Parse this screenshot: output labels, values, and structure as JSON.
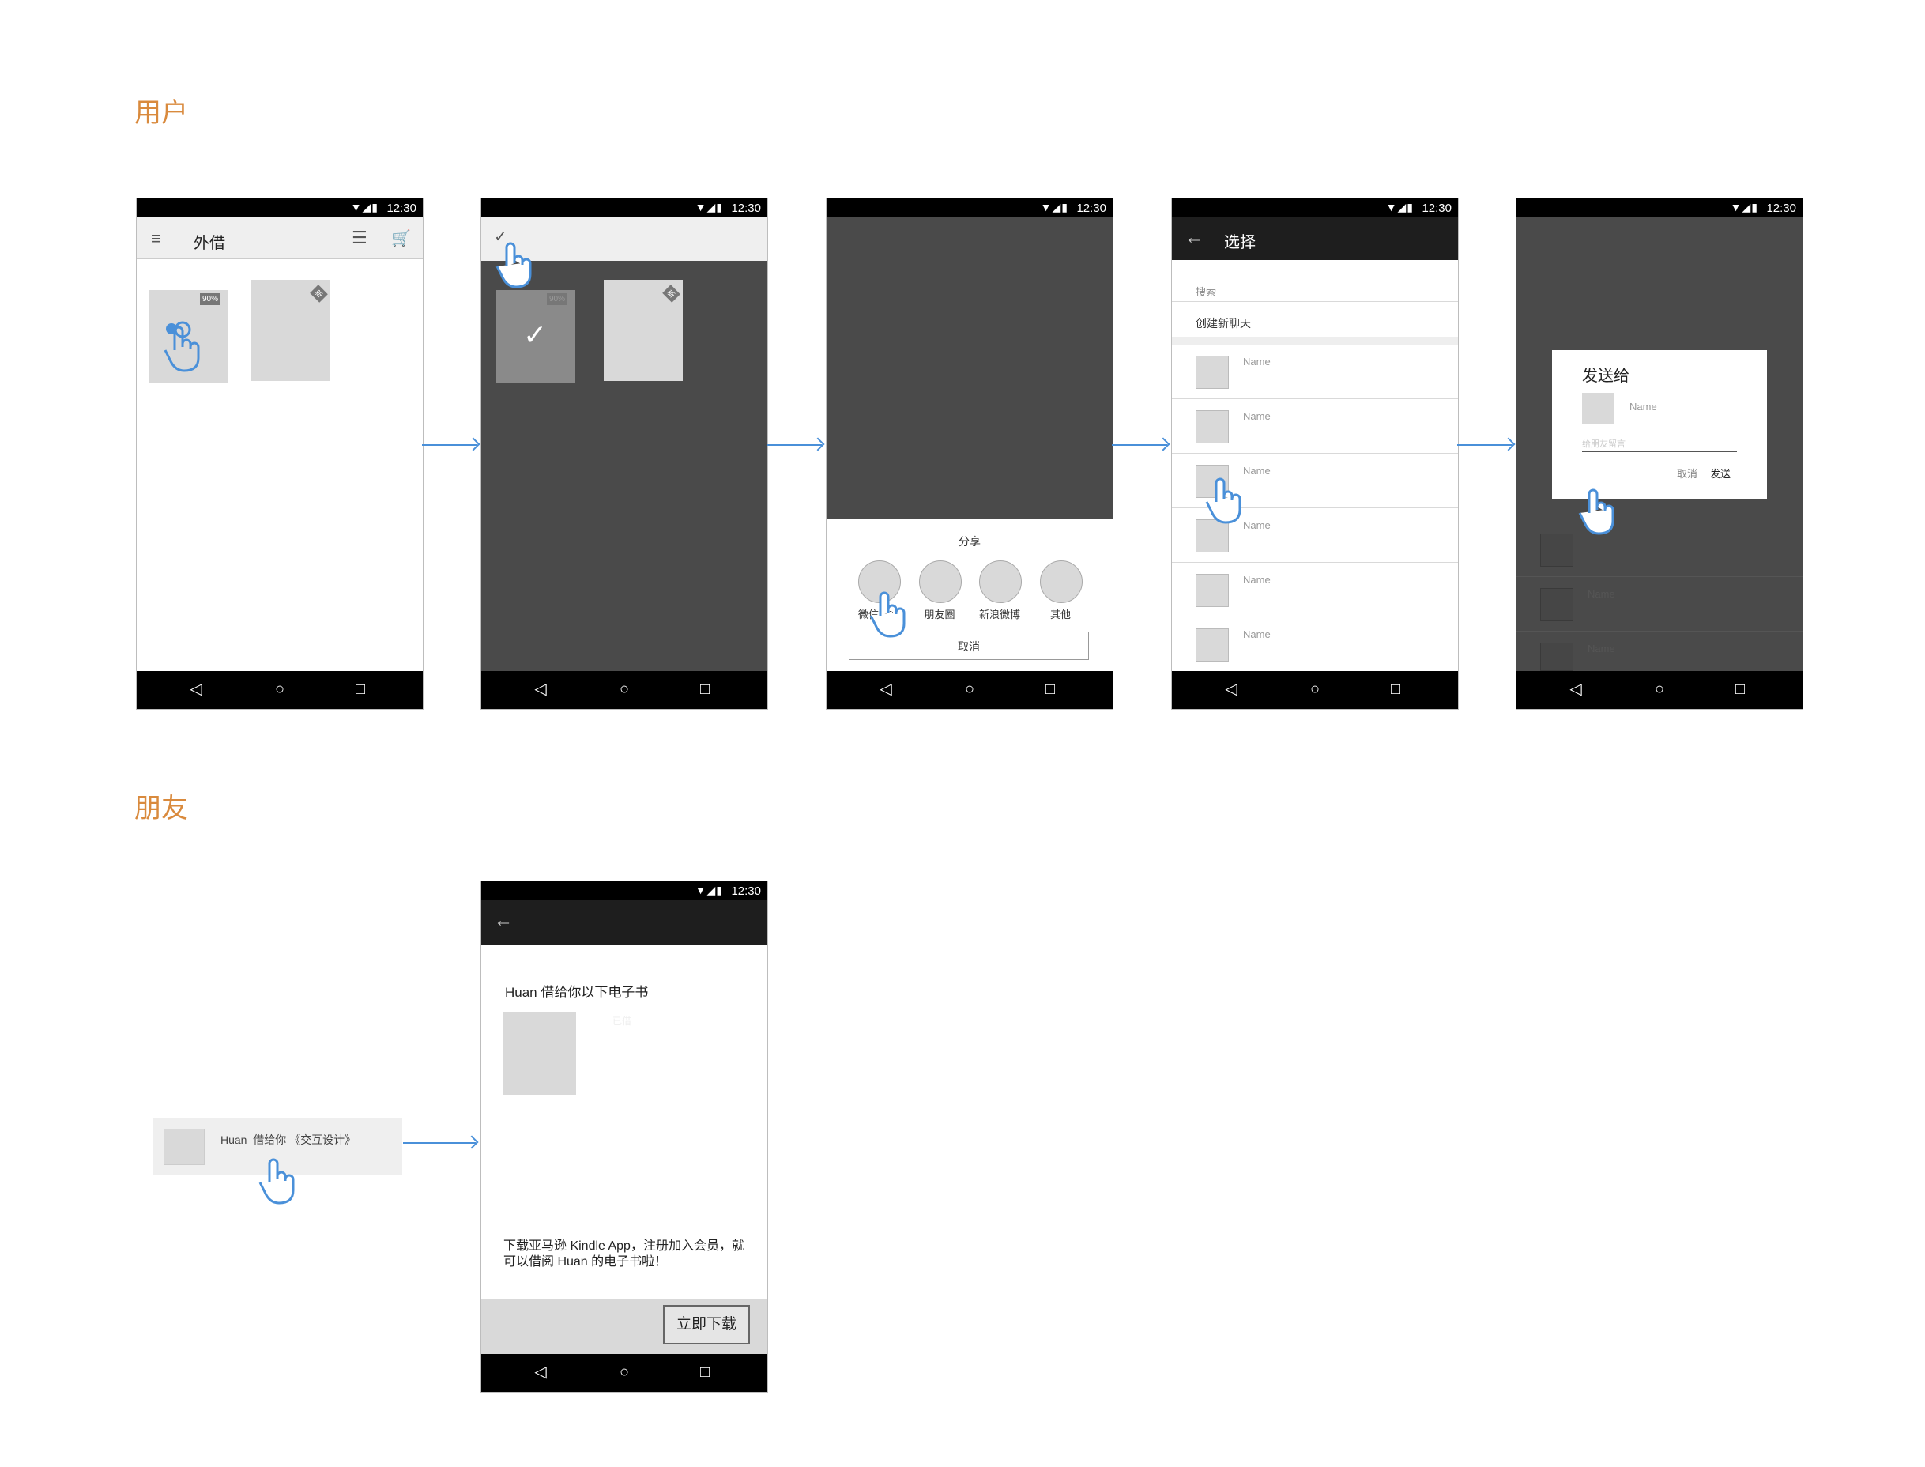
{
  "sections": {
    "user": "用户",
    "friend": "朋友"
  },
  "status": {
    "time": "12:30"
  },
  "screen1": {
    "title": "外借",
    "badge": "90%",
    "corner": "新"
  },
  "screen2": {
    "badge": "90%",
    "corner": "新"
  },
  "screen3": {
    "share_title": "分享",
    "options": [
      "微信好友",
      "朋友圈",
      "新浪微博",
      "其他"
    ],
    "cancel": "取消"
  },
  "screen4": {
    "title": "选择",
    "search": "搜索",
    "new_chat": "创建新聊天",
    "names": [
      "Name",
      "Name",
      "Name",
      "Name",
      "Name",
      "Name"
    ]
  },
  "screen5": {
    "dialog_title": "发送给",
    "name": "Name",
    "placeholder": "给朋友留言",
    "cancel": "取消",
    "send": "发送",
    "bg_names": [
      "Name",
      "Name"
    ]
  },
  "notification": {
    "text": "Huan  借给你 《交互设计》"
  },
  "screen6": {
    "heading": "Huan 借给你以下电子书",
    "borrowed_label": "已借",
    "promo": "下载亚马逊 Kindle App，注册加入会员，就可以借阅 Huan 的电子书啦！",
    "download": "立即下载"
  },
  "icon_names": [
    "hamburger-icon",
    "sort-icon",
    "cart-icon",
    "back-arrow-icon",
    "check-icon",
    "hand-pointer-icon",
    "wifi-icon",
    "signal-icon",
    "battery-icon"
  ],
  "colors": {
    "accent": "#d98a3d",
    "arrow": "#4a90d9",
    "hand": "#4a90d9"
  }
}
